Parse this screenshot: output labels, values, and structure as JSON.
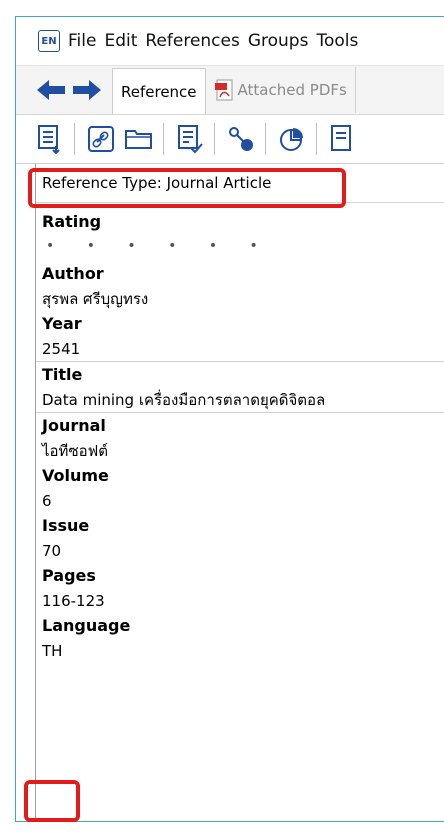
{
  "app": {
    "icon_text": "EN"
  },
  "menu": {
    "items": [
      "File",
      "Edit",
      "References",
      "Groups",
      "Tools"
    ]
  },
  "tabs": [
    {
      "label": "Reference",
      "active": true
    },
    {
      "label": "Attached PDFs",
      "active": false
    }
  ],
  "reference": {
    "type_label": "Reference Type: Journal Article",
    "fields": {
      "rating": {
        "label": "Rating",
        "value": "• • • • • •"
      },
      "author": {
        "label": "Author",
        "value": "สุรพล ศรีบุญทรง"
      },
      "year": {
        "label": "Year",
        "value": "2541"
      },
      "title": {
        "label": "Title",
        "value": "Data mining เครื่องมือการตลาดยุคดิจิตอล"
      },
      "journal": {
        "label": "Journal",
        "value": "ไอทีซอฟต์"
      },
      "volume": {
        "label": "Volume",
        "value": "6"
      },
      "issue": {
        "label": "Issue",
        "value": "70"
      },
      "pages": {
        "label": "Pages",
        "value": "116-123"
      },
      "language": {
        "label": "Language",
        "value": "TH"
      }
    }
  },
  "colors": {
    "highlight": "#e21b1b",
    "frame": "#4a9fd6",
    "icon_blue": "#1f4ea3"
  }
}
